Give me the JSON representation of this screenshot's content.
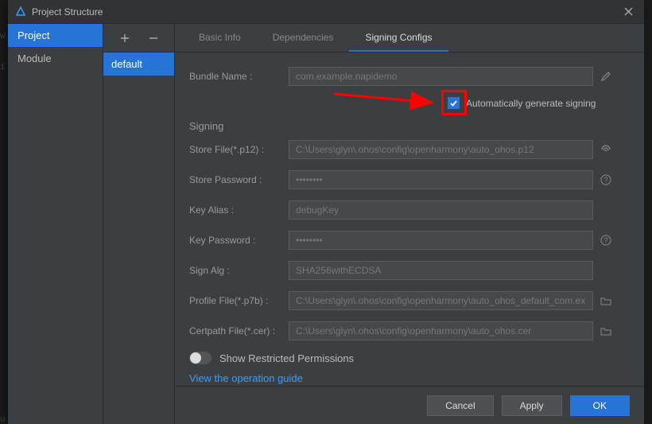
{
  "window": {
    "title": "Project Structure"
  },
  "left_nav": {
    "items": [
      {
        "label": "Project",
        "active": true
      },
      {
        "label": "Module",
        "active": false
      }
    ]
  },
  "mid": {
    "add_tooltip": "+",
    "remove_tooltip": "−",
    "items": [
      {
        "label": "default",
        "selected": true
      }
    ]
  },
  "tabs": [
    {
      "label": "Basic Info",
      "active": false
    },
    {
      "label": "Dependencies",
      "active": false
    },
    {
      "label": "Signing Configs",
      "active": true
    }
  ],
  "form": {
    "bundle_name_label": "Bundle Name :",
    "bundle_name_value": "com.example.napidemo",
    "auto_sign_label": "Automatically generate signing",
    "auto_sign_checked": true,
    "signing_section": "Signing",
    "store_file_label": "Store File(*.p12) :",
    "store_file_value": "C:\\Users\\glyn\\.ohos\\config\\openharmony\\auto_ohos.p12",
    "store_password_label": "Store Password :",
    "store_password_value": "••••••••",
    "key_alias_label": "Key Alias :",
    "key_alias_value": "debugKey",
    "key_password_label": "Key Password :",
    "key_password_value": "••••••••",
    "sign_alg_label": "Sign Alg :",
    "sign_alg_value": "SHA256withECDSA",
    "profile_file_label": "Profile File(*.p7b) :",
    "profile_file_value": "C:\\Users\\glyn\\.ohos\\config\\openharmony\\auto_ohos_default_com.example.n",
    "cert_file_label": "Certpath File(*.cer) :",
    "cert_file_value": "C:\\Users\\glyn\\.ohos\\config\\openharmony\\auto_ohos.cer",
    "restricted_label": "Show Restricted Permissions",
    "guide_link": "View the operation guide"
  },
  "footer": {
    "cancel": "Cancel",
    "apply": "Apply",
    "ok": "OK"
  }
}
